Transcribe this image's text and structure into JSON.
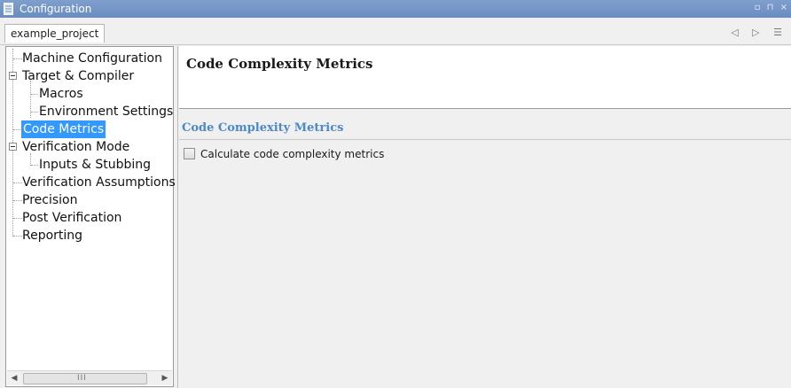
{
  "window": {
    "title": "Configuration",
    "controls": "▫ ⊓ ×"
  },
  "project_tab": {
    "label": "example_project",
    "nav": "◁ ▷ ☰"
  },
  "tree": {
    "items": [
      {
        "label": "Machine Configuration",
        "selected": false
      },
      {
        "label": "Target & Compiler",
        "selected": false,
        "expanded": true
      },
      {
        "label": "Macros",
        "selected": false
      },
      {
        "label": "Environment Settings",
        "selected": false
      },
      {
        "label": "Code Metrics",
        "selected": true
      },
      {
        "label": "Verification Mode",
        "selected": false,
        "expanded": true
      },
      {
        "label": "Inputs & Stubbing",
        "selected": false
      },
      {
        "label": "Verification Assumptions",
        "selected": false
      },
      {
        "label": "Precision",
        "selected": false
      },
      {
        "label": "Post Verification",
        "selected": false
      },
      {
        "label": "Reporting",
        "selected": false
      }
    ]
  },
  "scrollbar": {
    "left_arrow": "◀",
    "right_arrow": "▶",
    "grip": "III"
  },
  "content": {
    "title": "Code Complexity Metrics",
    "section_title": "Code Complexity Metrics",
    "option_label": "Calculate code complexity metrics",
    "option_checked": false
  },
  "colors": {
    "titlebar": "#7593c6",
    "selection": "#3399ff",
    "section_title": "#4d88c7"
  }
}
